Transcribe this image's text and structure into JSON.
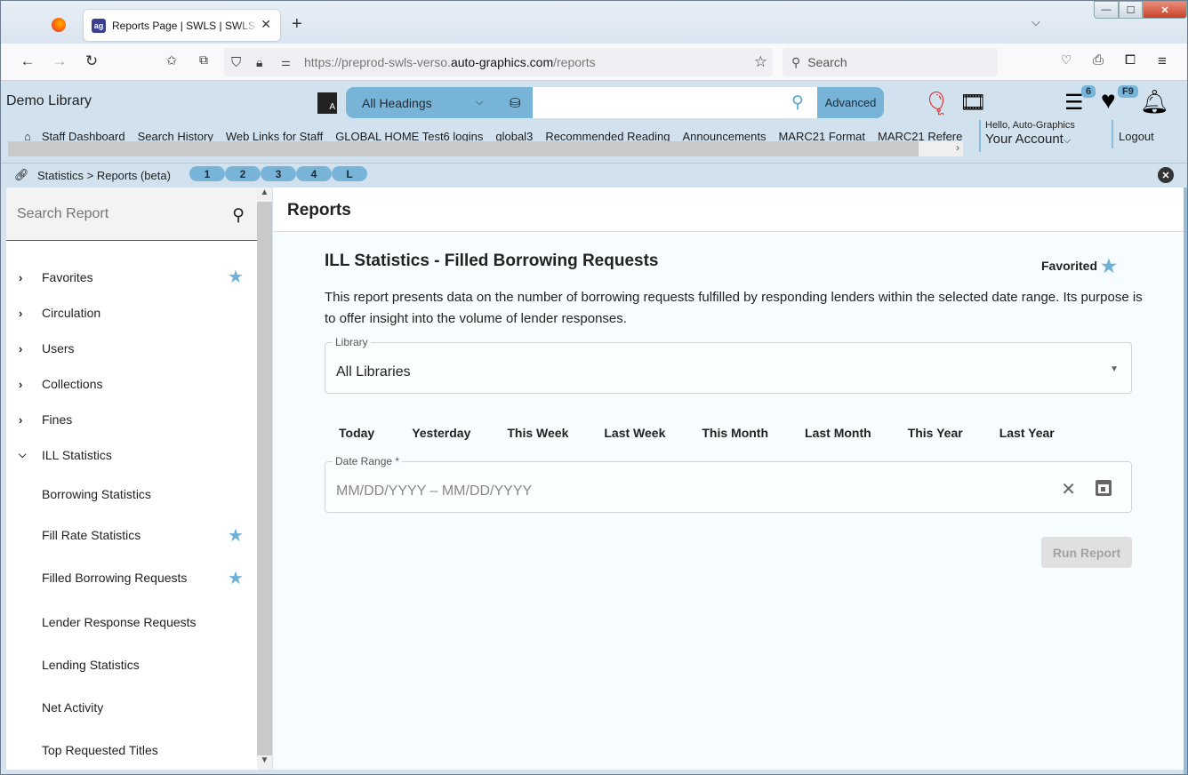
{
  "browser": {
    "tab_title": "Reports Page | SWLS | SWLS | Auto-Graphics",
    "url_prefix": "https://preprod-swls-verso.",
    "url_domain": "auto-graphics.com",
    "url_path": "/reports",
    "search_placeholder": "Search",
    "icons": {
      "back": "←",
      "forward": "→",
      "reload": "↻",
      "star": "☆",
      "newtab": "+",
      "tablist": "⌵",
      "close": "✕",
      "menu": "≡",
      "min": "—",
      "max": "☐",
      "wclose": "✕"
    }
  },
  "header": {
    "brand": "Demo Library",
    "search_scope": "All Headings",
    "search_value": "",
    "advanced_label": "Advanced",
    "list_badge": "6",
    "fav_badge": "F9",
    "greeting": "Hello, Auto-Graphics",
    "account_label": "Your Account",
    "logout_label": "Logout",
    "nav_links": [
      "Staff Dashboard",
      "Search History",
      "Web Links for Staff",
      "GLOBAL HOME Test6 logins",
      "global3",
      "Recommended Reading",
      "Announcements",
      "MARC21 Format",
      "MARC21 Refere"
    ]
  },
  "breadcrumb": {
    "text": "Statistics > Reports (beta)",
    "pills": [
      "1",
      "2",
      "3",
      "4",
      "L"
    ]
  },
  "sidebar": {
    "search_placeholder": "Search Report",
    "categories": [
      {
        "label": "Favorites",
        "expanded": false,
        "favorite": true
      },
      {
        "label": "Circulation",
        "expanded": false,
        "favorite": false
      },
      {
        "label": "Users",
        "expanded": false,
        "favorite": false
      },
      {
        "label": "Collections",
        "expanded": false,
        "favorite": false
      },
      {
        "label": "Fines",
        "expanded": false,
        "favorite": false
      },
      {
        "label": "ILL Statistics",
        "expanded": true,
        "favorite": false
      }
    ],
    "ill_items": [
      {
        "label": "Borrowing Statistics",
        "favorite": false
      },
      {
        "label": "Fill Rate Statistics",
        "favorite": true
      },
      {
        "label": "Filled Borrowing Requests",
        "favorite": true
      },
      {
        "label": "Lender Response Requests",
        "favorite": false
      },
      {
        "label": "Lending Statistics",
        "favorite": false
      },
      {
        "label": "Net Activity",
        "favorite": false
      },
      {
        "label": "Top Requested Titles",
        "favorite": false
      }
    ]
  },
  "main": {
    "heading": "Reports",
    "report_title": "ILL Statistics - Filled Borrowing Requests",
    "favorited_label": "Favorited",
    "description": "This report presents data on the number of borrowing requests fulfilled by responding lenders within the selected date range. Its purpose is to offer insight into the volume of lender responses.",
    "library_label": "Library",
    "library_value": "All Libraries",
    "quick_ranges": [
      "Today",
      "Yesterday",
      "This Week",
      "Last Week",
      "This Month",
      "Last Month",
      "This Year",
      "Last Year"
    ],
    "date_range_label": "Date Range *",
    "date_range_placeholder": "MM/DD/YYYY – MM/DD/YYYY",
    "run_label": "Run Report",
    "accent_color": "#78b4d8",
    "star_color": "#6fb0d8"
  }
}
